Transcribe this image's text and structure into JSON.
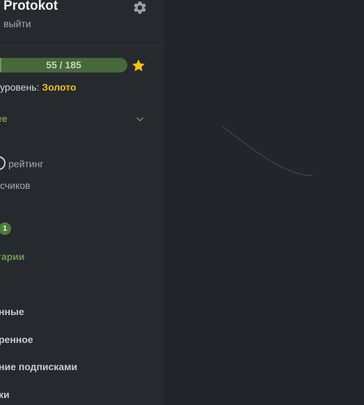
{
  "profile": {
    "username": "Protokot",
    "logout_label": "выйти",
    "settings_icon": "gear-icon"
  },
  "progress": {
    "label": "55 / 185",
    "current": 55,
    "total": 185,
    "star_icon": "star-icon"
  },
  "level": {
    "prefix": "уровень:",
    "value": "Золото",
    "value_color": "#f2c21a"
  },
  "more": {
    "label": "ее",
    "icon": "chevron-down-icon"
  },
  "stats": {
    "rating_label": "рейтинг",
    "subscribers_label": "счиков"
  },
  "badge": {
    "count": "1"
  },
  "comments": {
    "label": "гарии"
  },
  "nav": {
    "items": [
      {
        "label": "нные"
      },
      {
        "label": "ренное"
      },
      {
        "label": "ние подписками"
      },
      {
        "label": "ки"
      }
    ]
  },
  "colors": {
    "sidebar_bg": "#262a2f",
    "main_bg": "#22262b",
    "accent_green": "#6f9a52",
    "gold": "#f2c21a"
  }
}
